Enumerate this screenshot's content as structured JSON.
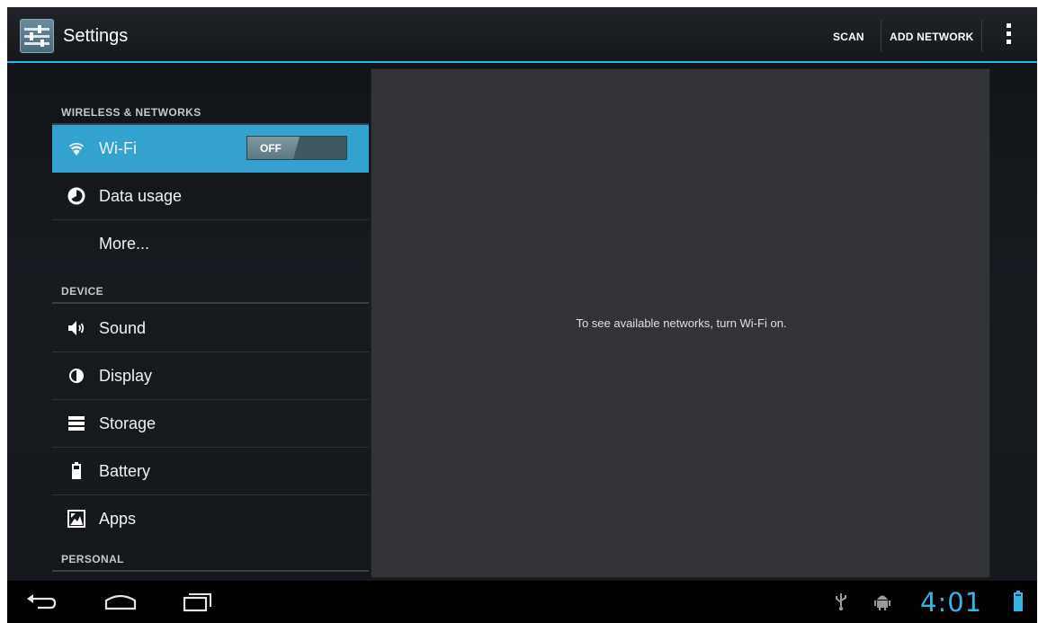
{
  "action_bar": {
    "title": "Settings",
    "actions": [
      "SCAN",
      "ADD NETWORK"
    ],
    "overflow_icon": "overflow-menu-icon",
    "accent_color": "#33b5e5"
  },
  "settings": {
    "sections": [
      {
        "header": "WIRELESS & NETWORKS",
        "items": [
          {
            "label": "Wi-Fi",
            "icon": "wifi-icon",
            "selected": true,
            "toggle": "OFF"
          },
          {
            "label": "Data usage",
            "icon": "data-usage-icon"
          },
          {
            "label": "More..."
          }
        ]
      },
      {
        "header": "DEVICE",
        "items": [
          {
            "label": "Sound",
            "icon": "sound-icon"
          },
          {
            "label": "Display",
            "icon": "display-icon"
          },
          {
            "label": "Storage",
            "icon": "storage-icon"
          },
          {
            "label": "Battery",
            "icon": "battery-icon"
          },
          {
            "label": "Apps",
            "icon": "apps-icon"
          }
        ]
      },
      {
        "header": "PERSONAL",
        "items": []
      }
    ],
    "selected_color": "#33a2cf"
  },
  "detail": {
    "message": "To see available networks, turn Wi-Fi on."
  },
  "system_bar": {
    "nav_icons": [
      "back-icon",
      "home-icon",
      "recent-apps-icon"
    ],
    "status_icons": [
      "usb-icon",
      "debug-icon",
      "battery-icon"
    ],
    "clock": "4:01"
  }
}
